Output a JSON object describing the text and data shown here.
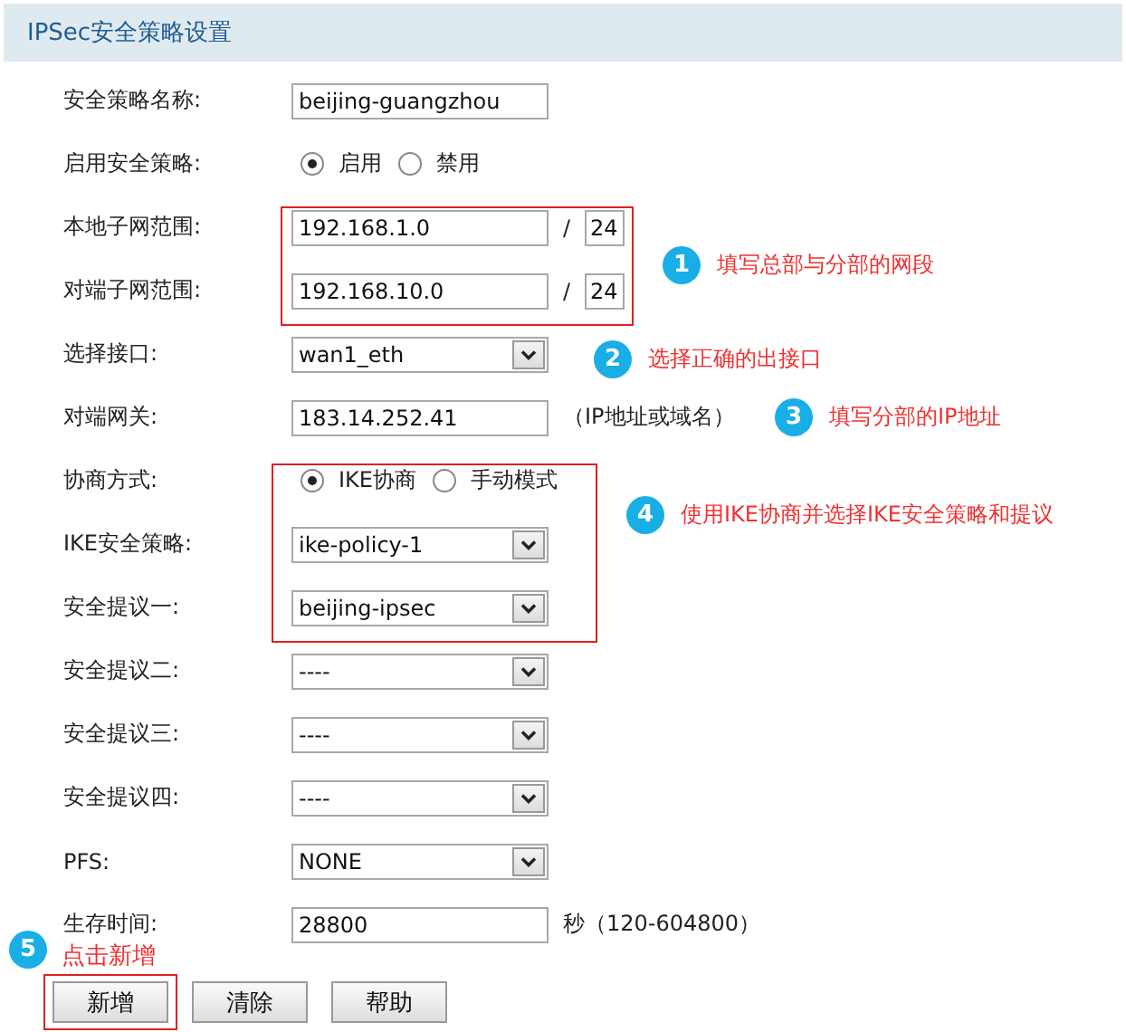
{
  "title": "IPSec安全策略设置",
  "fields": [
    {
      "kind": "text",
      "label": "安全策略名称:",
      "value": "beijing-guangzhou"
    },
    {
      "kind": "radio",
      "label": "启用安全策略:",
      "options": [
        {
          "label": "启用",
          "selected": true
        },
        {
          "label": "禁用",
          "selected": false
        }
      ]
    },
    {
      "kind": "subnet",
      "label": "本地子网范围:",
      "value": "192.168.1.0",
      "separator": "/",
      "prefix": "24"
    },
    {
      "kind": "subnet",
      "label": "对端子网范围:",
      "value": "192.168.10.0",
      "separator": "/",
      "prefix": "24"
    },
    {
      "kind": "select",
      "label": "选择接口:",
      "value": "wan1_eth"
    },
    {
      "kind": "text",
      "label": "对端网关:",
      "value": "183.14.252.41",
      "suffix": "（IP地址或域名）"
    },
    {
      "kind": "radio",
      "label": "协商方式:",
      "options": [
        {
          "label": "IKE协商",
          "selected": true
        },
        {
          "label": "手动模式",
          "selected": false
        }
      ]
    },
    {
      "kind": "select",
      "label": "IKE安全策略:",
      "value": "ike-policy-1"
    },
    {
      "kind": "select",
      "label": "安全提议一:",
      "value": "beijing-ipsec"
    },
    {
      "kind": "select",
      "label": "安全提议二:",
      "value": "----"
    },
    {
      "kind": "select",
      "label": "安全提议三:",
      "value": "----"
    },
    {
      "kind": "select",
      "label": "安全提议四:",
      "value": "----"
    },
    {
      "kind": "select",
      "label": "PFS:",
      "value": "NONE"
    },
    {
      "kind": "text",
      "label": "生存时间:",
      "value": "28800",
      "suffix": "秒（120-604800）"
    }
  ],
  "annotations": [
    {
      "number": "1",
      "text": "填写总部与分部的网段"
    },
    {
      "number": "2",
      "text": "选择正确的出接口"
    },
    {
      "number": "3",
      "text": "填写分部的IP地址"
    },
    {
      "number": "4",
      "text": "使用IKE协商并选择IKE安全策略和提议"
    },
    {
      "number": "5",
      "text": "点击新增"
    }
  ],
  "buttons": [
    {
      "label": "新增",
      "highlighted": true
    },
    {
      "label": "清除",
      "highlighted": false
    },
    {
      "label": "帮助",
      "highlighted": false
    }
  ]
}
